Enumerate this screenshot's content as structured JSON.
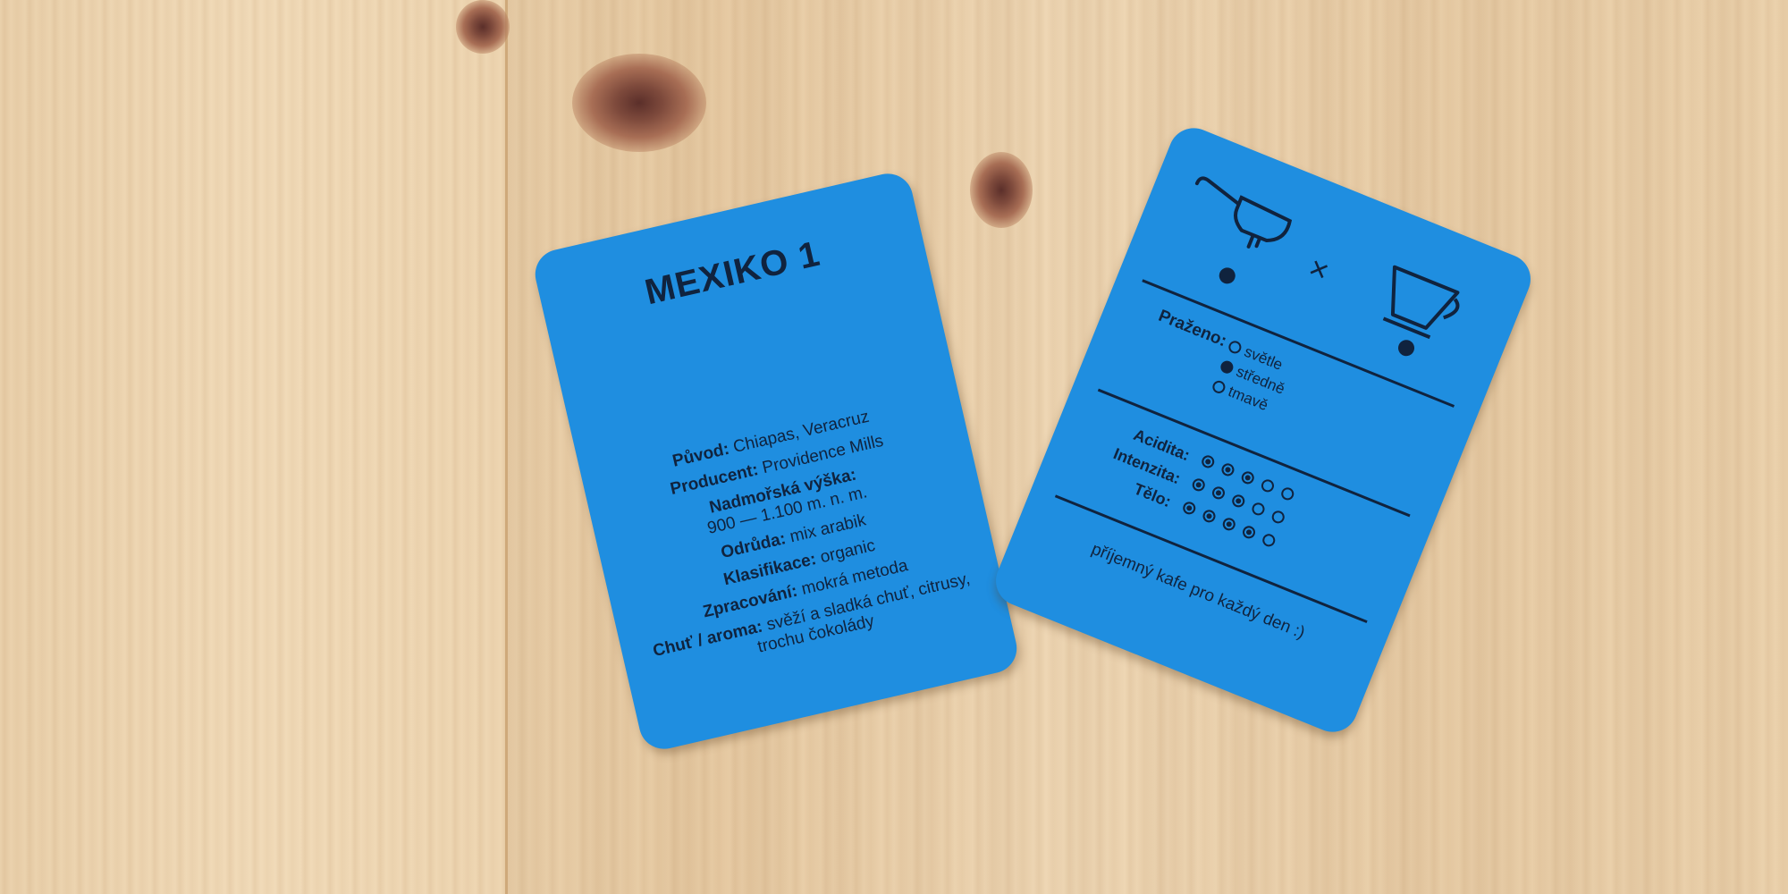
{
  "front_card": {
    "title": "MEXIKO 1",
    "rows": [
      {
        "label": "Původ:",
        "value": "Chiapas, Veracruz"
      },
      {
        "label": "Producent:",
        "value": "Providence Mills"
      },
      {
        "label": "Nadmořská výška:",
        "value": "900 — 1.100 m. n. m."
      },
      {
        "label": "Odrůda:",
        "value": "mix arabik"
      },
      {
        "label": "Klasifikace:",
        "value": "organic"
      },
      {
        "label": "Zpracování:",
        "value": "mokrá metoda"
      },
      {
        "label": "Chuť / aroma:",
        "value": "svěží a sladká chuť, citrusy, trochu čokolády"
      }
    ]
  },
  "back_card": {
    "brew_symbol": "×",
    "brew_methods": [
      {
        "icon": "espresso-portafilter-icon",
        "selected": true
      },
      {
        "icon": "pour-over-dripper-icon",
        "selected": true
      }
    ],
    "roast_label": "Praženo:",
    "roast_options": [
      {
        "label": "světle",
        "selected": false
      },
      {
        "label": "středně",
        "selected": true
      },
      {
        "label": "tmavě",
        "selected": false
      }
    ],
    "scales": [
      {
        "label": "Acidita:",
        "level": 3,
        "max": 5
      },
      {
        "label": "Intenzita:",
        "level": 3,
        "max": 5
      },
      {
        "label": "Tělo:",
        "level": 4,
        "max": 5
      }
    ],
    "note": "příjemný kafe pro každý den :)"
  },
  "colors": {
    "card": "#1f8ee0",
    "ink": "#10233e",
    "wood": "#ecd3ae"
  }
}
